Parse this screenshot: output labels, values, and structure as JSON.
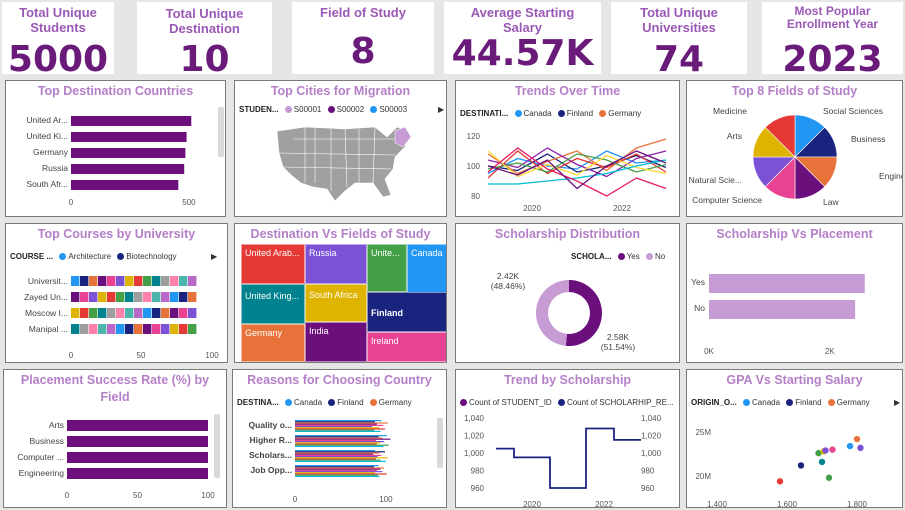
{
  "kpis": [
    {
      "label": "Total Unique Students",
      "value": "5000"
    },
    {
      "label": "Total Unique Destination",
      "value": "10"
    },
    {
      "label": "Field of Study",
      "value": "8"
    },
    {
      "label": "Average Starting Salary",
      "value": "44.57K"
    },
    {
      "label": "Total Unique Universities",
      "value": "74"
    },
    {
      "label": "Most Popular Enrollment Year",
      "value": "2023"
    }
  ],
  "colors": {
    "purple": "#6a0f7c",
    "light_purple": "#c79bd4",
    "title": "#b57fc8"
  },
  "top_destinations": {
    "title": "Top Destination Countries",
    "categories": [
      "United Ar...",
      "United Ki...",
      "Germany",
      "Russia",
      "South Afr..."
    ],
    "values": [
      510,
      490,
      485,
      480,
      455
    ],
    "ticks": [
      "0",
      "500"
    ]
  },
  "top_cities": {
    "title": "Top Cities for Migration",
    "legend_label": "STUDEN...",
    "legend": [
      {
        "name": "S00001",
        "color": "#c79bd4"
      },
      {
        "name": "S00002",
        "color": "#6a0f7c"
      },
      {
        "name": "S00003",
        "color": "#2196f3"
      }
    ]
  },
  "trends": {
    "title": "Trends Over Time",
    "legend_label": "DESTINATI...",
    "legend": [
      {
        "name": "Canada",
        "color": "#2196f3"
      },
      {
        "name": "Finland",
        "color": "#1a237e"
      },
      {
        "name": "Germany",
        "color": "#e8733a"
      }
    ],
    "yticks": [
      "120",
      "100",
      "80"
    ],
    "xticks": [
      "2020",
      "2022"
    ],
    "series": [
      {
        "color": "#2196f3",
        "values": [
          95,
          105,
          100,
          98,
          110,
          102,
          104
        ]
      },
      {
        "color": "#1a237e",
        "values": [
          100,
          97,
          108,
          96,
          100,
          107,
          99
        ]
      },
      {
        "color": "#e8733a",
        "values": [
          108,
          95,
          103,
          110,
          97,
          112,
          118
        ]
      },
      {
        "color": "#e53935",
        "values": [
          92,
          110,
          95,
          105,
          99,
          108,
          96
        ]
      },
      {
        "color": "#8e24aa",
        "values": [
          104,
          99,
          112,
          101,
          93,
          105,
          110
        ]
      },
      {
        "color": "#43a047",
        "values": [
          98,
          102,
          96,
          108,
          104,
          96,
          101
        ]
      },
      {
        "color": "#fdd835",
        "values": [
          110,
          93,
          101,
          94,
          107,
          99,
          95
        ]
      },
      {
        "color": "#00bcd4",
        "values": [
          88,
          88,
          90,
          92,
          95,
          100,
          104
        ]
      },
      {
        "color": "#e91e63",
        "values": [
          96,
          112,
          98,
          90,
          80,
          92,
          85
        ]
      },
      {
        "color": "#6a0f7c",
        "values": [
          100,
          94,
          104,
          85,
          100,
          110,
          102
        ]
      }
    ]
  },
  "fields": {
    "title": "Top 8 Fields of Study",
    "labels": [
      "Medicine",
      "Social Sciences",
      "Arts",
      "Business",
      "Engineering",
      "Natural Scie...",
      "Law",
      "Computer Science"
    ],
    "slices": [
      {
        "name": "Social Sciences",
        "value": 12.5,
        "color": "#2196f3"
      },
      {
        "name": "Business",
        "value": 12.5,
        "color": "#1a237e"
      },
      {
        "name": "Engineering",
        "value": 12.5,
        "color": "#e8733a"
      },
      {
        "name": "Law",
        "value": 12.5,
        "color": "#6a0f7c"
      },
      {
        "name": "Computer Science",
        "value": 12.5,
        "color": "#e84393"
      },
      {
        "name": "Natural Scie...",
        "value": 12.5,
        "color": "#7b52d6"
      },
      {
        "name": "Arts",
        "value": 12.5,
        "color": "#dfb400"
      },
      {
        "name": "Medicine",
        "value": 12.5,
        "color": "#e53935"
      }
    ]
  },
  "courses": {
    "title": "Top Courses by University",
    "legend_label": "COURSE ...",
    "legend": [
      {
        "name": "Architecture",
        "color": "#2196f3"
      },
      {
        "name": "Biotechnology",
        "color": "#1a237e"
      }
    ],
    "categories": [
      "Universit...",
      "Zayed Un...",
      "Moscow I...",
      "Manipal ..."
    ],
    "ticks": [
      "0",
      "50",
      "100"
    ],
    "palette": [
      "#2196f3",
      "#1a237e",
      "#e8733a",
      "#6a0f7c",
      "#e84393",
      "#7b52d6",
      "#dfb400",
      "#e53935",
      "#43a047",
      "#00838f",
      "#9e9e9e",
      "#ff80ab",
      "#4db6ac",
      "#ba68c8"
    ]
  },
  "treemap": {
    "title": "Destination Vs Fields of Study",
    "tiles": [
      "United Arab...",
      "Russia",
      "Unite...",
      "Canada",
      "United King...",
      "South Africa",
      "Finland",
      "Germany",
      "India",
      "Ireland"
    ]
  },
  "scholarship_dist": {
    "title": "Scholarship Distribution",
    "legend_label": "SCHOLA...",
    "legend": [
      {
        "name": "Yes",
        "color": "#6a0f7c"
      },
      {
        "name": "No",
        "color": "#c79bd4"
      }
    ],
    "yes_value": "2.58K",
    "yes_pct": "(51.54%)",
    "no_value": "2.42K",
    "no_pct": "(48.46%)",
    "yes_fraction": 0.5154
  },
  "scholarship_placement": {
    "title": "Scholarship Vs Placement",
    "categories": [
      "Yes",
      "No"
    ],
    "values": [
      2580,
      2420
    ],
    "ticks": [
      "0K",
      "2K"
    ]
  },
  "placement": {
    "title": "Placement Success Rate (%) by Field",
    "categories": [
      "Arts",
      "Business",
      "Computer ...",
      "Engineering"
    ],
    "values": [
      100,
      100,
      100,
      100
    ],
    "ticks": [
      "0",
      "50",
      "100"
    ]
  },
  "reasons": {
    "title": "Reasons for Choosing Country",
    "legend_label": "DESTINA...",
    "legend": [
      {
        "name": "Canada",
        "color": "#2196f3"
      },
      {
        "name": "Finland",
        "color": "#1a237e"
      },
      {
        "name": "Germany",
        "color": "#e8733a"
      }
    ],
    "categories": [
      "Quality o...",
      "Higher R...",
      "Scholars...",
      "Job Opp..."
    ],
    "ticks": [
      "0",
      "100"
    ],
    "series_colors": [
      "#2196f3",
      "#1a237e",
      "#e8733a",
      "#6a0f7c",
      "#e84393",
      "#7b52d6",
      "#dfb400",
      "#e53935",
      "#43a047",
      "#00bcd4"
    ],
    "values": [
      [
        95,
        88,
        102,
        90,
        97,
        85,
        93,
        99,
        87,
        94
      ],
      [
        101,
        92,
        96,
        105,
        89,
        98,
        94,
        90,
        103,
        97
      ],
      [
        88,
        99,
        93,
        86,
        95,
        91,
        102,
        89,
        94,
        100
      ],
      [
        92,
        87,
        98,
        94,
        90,
        96,
        88,
        101,
        91,
        93
      ]
    ]
  },
  "trend_scholarship": {
    "title": "Trend by Scholarship",
    "legend": [
      {
        "name": "Count of STUDENT_ID",
        "color": "#6a0f7c"
      },
      {
        "name": "Count of SCHOLARHIP_RE...",
        "color": "#1a237e"
      }
    ],
    "yticks_left": [
      "1,040",
      "1,020",
      "1,000",
      "980",
      "960"
    ],
    "yticks_right": [
      "1,040",
      "1,020",
      "1,000",
      "980",
      "960"
    ],
    "xticks": [
      "2020",
      "2022"
    ],
    "x": [
      2019,
      2020,
      2021,
      2022,
      2023
    ],
    "values": [
      1005,
      995,
      960,
      1028,
      1015
    ]
  },
  "gpa_salary": {
    "title": "GPA Vs Starting Salary",
    "legend_label": "ORIGIN_O...",
    "legend": [
      {
        "name": "Canada",
        "color": "#2196f3"
      },
      {
        "name": "Finland",
        "color": "#1a237e"
      },
      {
        "name": "Germany",
        "color": "#e8733a"
      }
    ],
    "yticks": [
      "25M",
      "20M"
    ],
    "xticks": [
      "1,400",
      "1,600",
      "1,800"
    ],
    "points": [
      {
        "x": 1580,
        "y": 19.4,
        "color": "#e53935"
      },
      {
        "x": 1640,
        "y": 21.2,
        "color": "#1a237e"
      },
      {
        "x": 1690,
        "y": 22.6,
        "color": "#43a047"
      },
      {
        "x": 1700,
        "y": 21.6,
        "color": "#00838f"
      },
      {
        "x": 1705,
        "y": 22.8,
        "color": "#dfb400"
      },
      {
        "x": 1710,
        "y": 22.9,
        "color": "#7b52d6"
      },
      {
        "x": 1720,
        "y": 19.8,
        "color": "#43a047"
      },
      {
        "x": 1730,
        "y": 23.0,
        "color": "#e84393"
      },
      {
        "x": 1780,
        "y": 23.4,
        "color": "#2196f3"
      },
      {
        "x": 1800,
        "y": 24.2,
        "color": "#e8733a"
      },
      {
        "x": 1810,
        "y": 23.2,
        "color": "#7b52d6"
      }
    ]
  }
}
